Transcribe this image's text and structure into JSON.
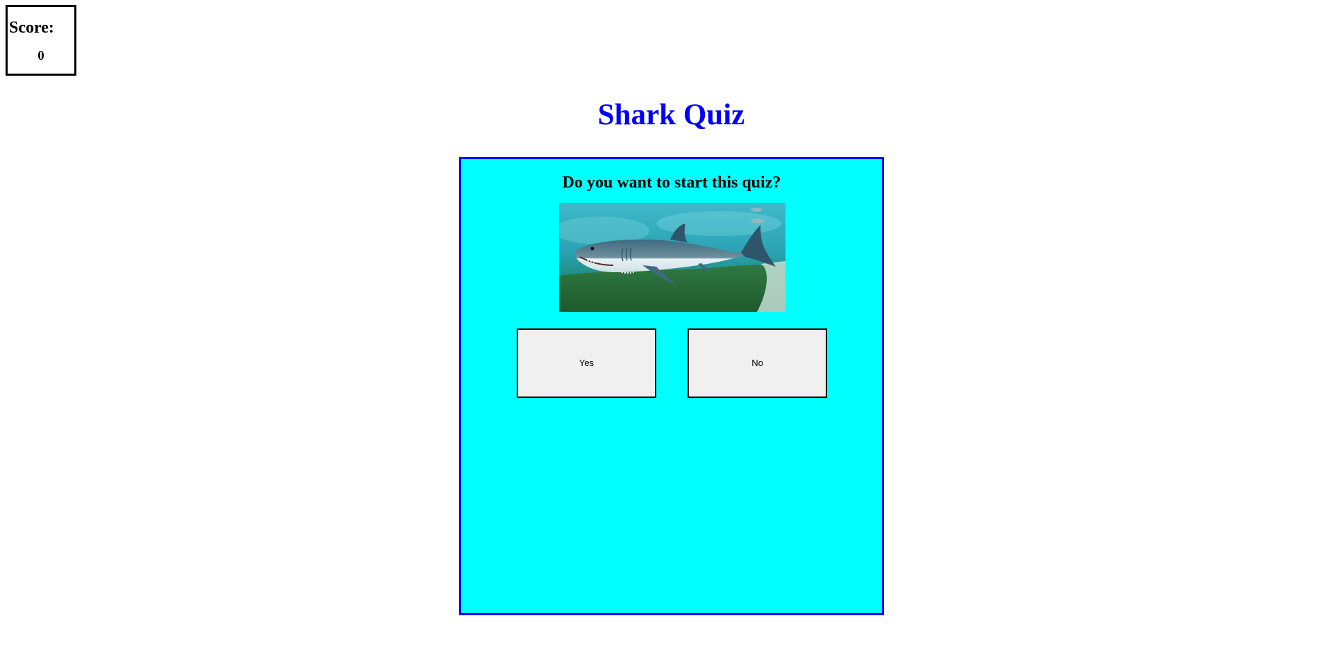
{
  "score": {
    "label": "Score:",
    "value": "0"
  },
  "page": {
    "title": "Shark Quiz"
  },
  "quiz": {
    "question": "Do you want to start this quiz?",
    "image_icon": "shark-photo",
    "yes_label": "Yes",
    "no_label": "No"
  },
  "colors": {
    "title": "#0000ff",
    "panel_background": "#00ffff",
    "panel_border": "#0000ff",
    "button_background": "#f0f0f0"
  }
}
